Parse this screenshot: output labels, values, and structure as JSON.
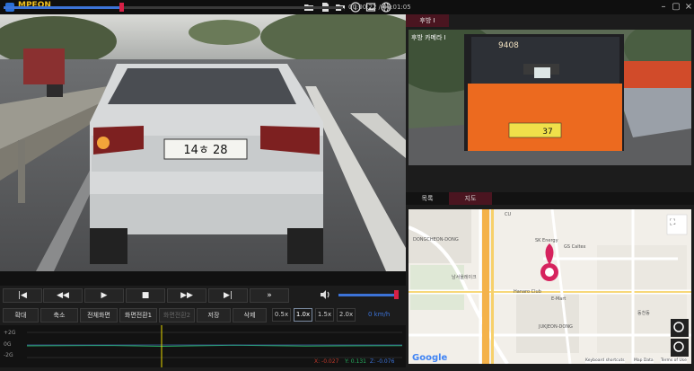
{
  "app": {
    "title": "MPEON"
  },
  "toolbar": {
    "icons": [
      "folder-icon",
      "sd-card-icon",
      "folder-settings-icon",
      "info-icon",
      "image-icon",
      "globe-icon"
    ]
  },
  "window": {
    "minimize": "–",
    "maximize": "▢",
    "close": "×"
  },
  "main_video": {
    "overlay_text": "",
    "plate": "14ㅎ 28"
  },
  "seek": {
    "current": "00:00:22",
    "total": "00:01:05",
    "time_label": "00:00:22 / 00:01:05",
    "progress": 0.34
  },
  "controls": {
    "prev_file": "|◀",
    "rewind": "◀◀",
    "play": "▶",
    "stop": "■",
    "forward": "▶▶",
    "next_file": "▶|",
    "skip": "»",
    "volume_level": 0.95
  },
  "actions": {
    "zoom_in": "확대",
    "zoom_out": "축소",
    "fullscreen": "전체화면",
    "screen_switch1": "화면전환1",
    "screen_switch2": "화면전환2",
    "save": "저장",
    "delete": "삭제"
  },
  "speeds": {
    "s05": "0.5x",
    "s10": "1.0x",
    "s15": "1.5x",
    "s20": "2.0x",
    "selected": "1.0x"
  },
  "speed_readout": "0 km/h",
  "graph": {
    "labels": {
      "pos": "+2G",
      "zero": "0G",
      "neg": "-2G"
    },
    "readout": {
      "x": "X: -0.027",
      "y": "Y: 0.131",
      "z": "Z: -0.076"
    },
    "colors": {
      "x": "#c0392b",
      "y": "#27ae60",
      "z": "#3c73d8",
      "cursor": "#e8d800"
    }
  },
  "rear": {
    "tab": "후방 I",
    "overlay_text": "후방 카메라 I",
    "bus_number": "9408",
    "bus_plate": "37"
  },
  "map_tabs": {
    "list": "목록",
    "map": "지도",
    "selected": "지도"
  },
  "map": {
    "labels": {
      "district1": "DONGCHEON-DONG",
      "district2": "JUKJEON-DONG",
      "poi1": "남서울레이크",
      "poi2": "SK Energy",
      "poi3": "GS Caltex",
      "poi4": "Hanaro Club",
      "poi5": "E-Mart",
      "poi6": "동천동",
      "road": "CU"
    },
    "google": "Google",
    "footer": {
      "shortcuts": "Keyboard shortcuts",
      "data": "Map Data",
      "terms": "Terms of Use"
    }
  }
}
